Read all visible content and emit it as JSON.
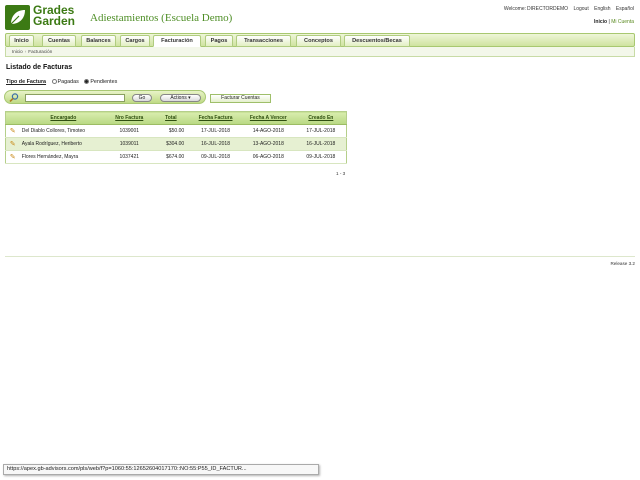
{
  "header": {
    "logo_line1": "Grades",
    "logo_line2": "Garden",
    "app_title": "Adiestamientos (Escuela Demo)",
    "welcome_label": "Welcome:",
    "user": "DIRECTORDEMO",
    "logout": "Logout",
    "lang_en": "English",
    "lang_es": "Español",
    "home_link": "Inicio",
    "separator": "|",
    "my_account": "Mi Cuenta"
  },
  "nav": {
    "tabs": [
      {
        "label": "Inicio",
        "active": false
      },
      {
        "label": "Cuentas",
        "active": false
      },
      {
        "label": "Balances",
        "active": false
      },
      {
        "label": "Cargos",
        "active": false
      },
      {
        "label": "Facturación",
        "active": true
      },
      {
        "label": "Pagos",
        "active": false
      },
      {
        "label": "Transacciones",
        "active": false
      },
      {
        "label": "Conceptos",
        "active": false
      },
      {
        "label": "Descuentos/Becas",
        "active": false
      }
    ]
  },
  "breadcrumb": {
    "home": "Inicio",
    "sep": "›",
    "current": "Facturación"
  },
  "region": {
    "title": "Listado de Facturas",
    "tipo_label": "Tipo de Factura",
    "opt_pagadas": "Pagadas",
    "opt_pendientes": "Pendientes",
    "selected": "Pendientes"
  },
  "search": {
    "value": "",
    "go_label": "Go",
    "actions_label": "Actions",
    "facturar_label": "Facturar Cuentas"
  },
  "table": {
    "columns": [
      "Encargado",
      "Nro Factura",
      "Total",
      "Fecha Factura",
      "Fecha A Vencer",
      "Creado En"
    ],
    "rows": [
      {
        "encargado": "Del Diablo Collores, Timoteo",
        "nro": "1039001",
        "total": "$50.00",
        "fecha": "17-JUL-2018",
        "vencer": "14-AGO-2018",
        "creado": "17-JUL-2018"
      },
      {
        "encargado": "Ayala Rodríguez, Heriberto",
        "nro": "1039011",
        "total": "$304.00",
        "fecha": "16-JUL-2018",
        "vencer": "13-AGO-2018",
        "creado": "16-JUL-2018"
      },
      {
        "encargado": "Flores Hernández, Mayra",
        "nro": "1037421",
        "total": "$674.00",
        "fecha": "09-JUL-2018",
        "vencer": "06-AGO-2018",
        "creado": "09-JUL-2018"
      }
    ],
    "pager": "1 - 3"
  },
  "footer": {
    "release": "Release 3.2"
  },
  "statusbar": {
    "url": "https://apex.gb-advisors.com/pls/web/f?p=1060:55:12652604017170::NO:55:P55_ID_FACTUR..."
  },
  "colors": {
    "brand": "#3c7a14",
    "title": "#4e8e26",
    "header_bg": "#b8d883",
    "row_alt": "#e6f0d2"
  }
}
